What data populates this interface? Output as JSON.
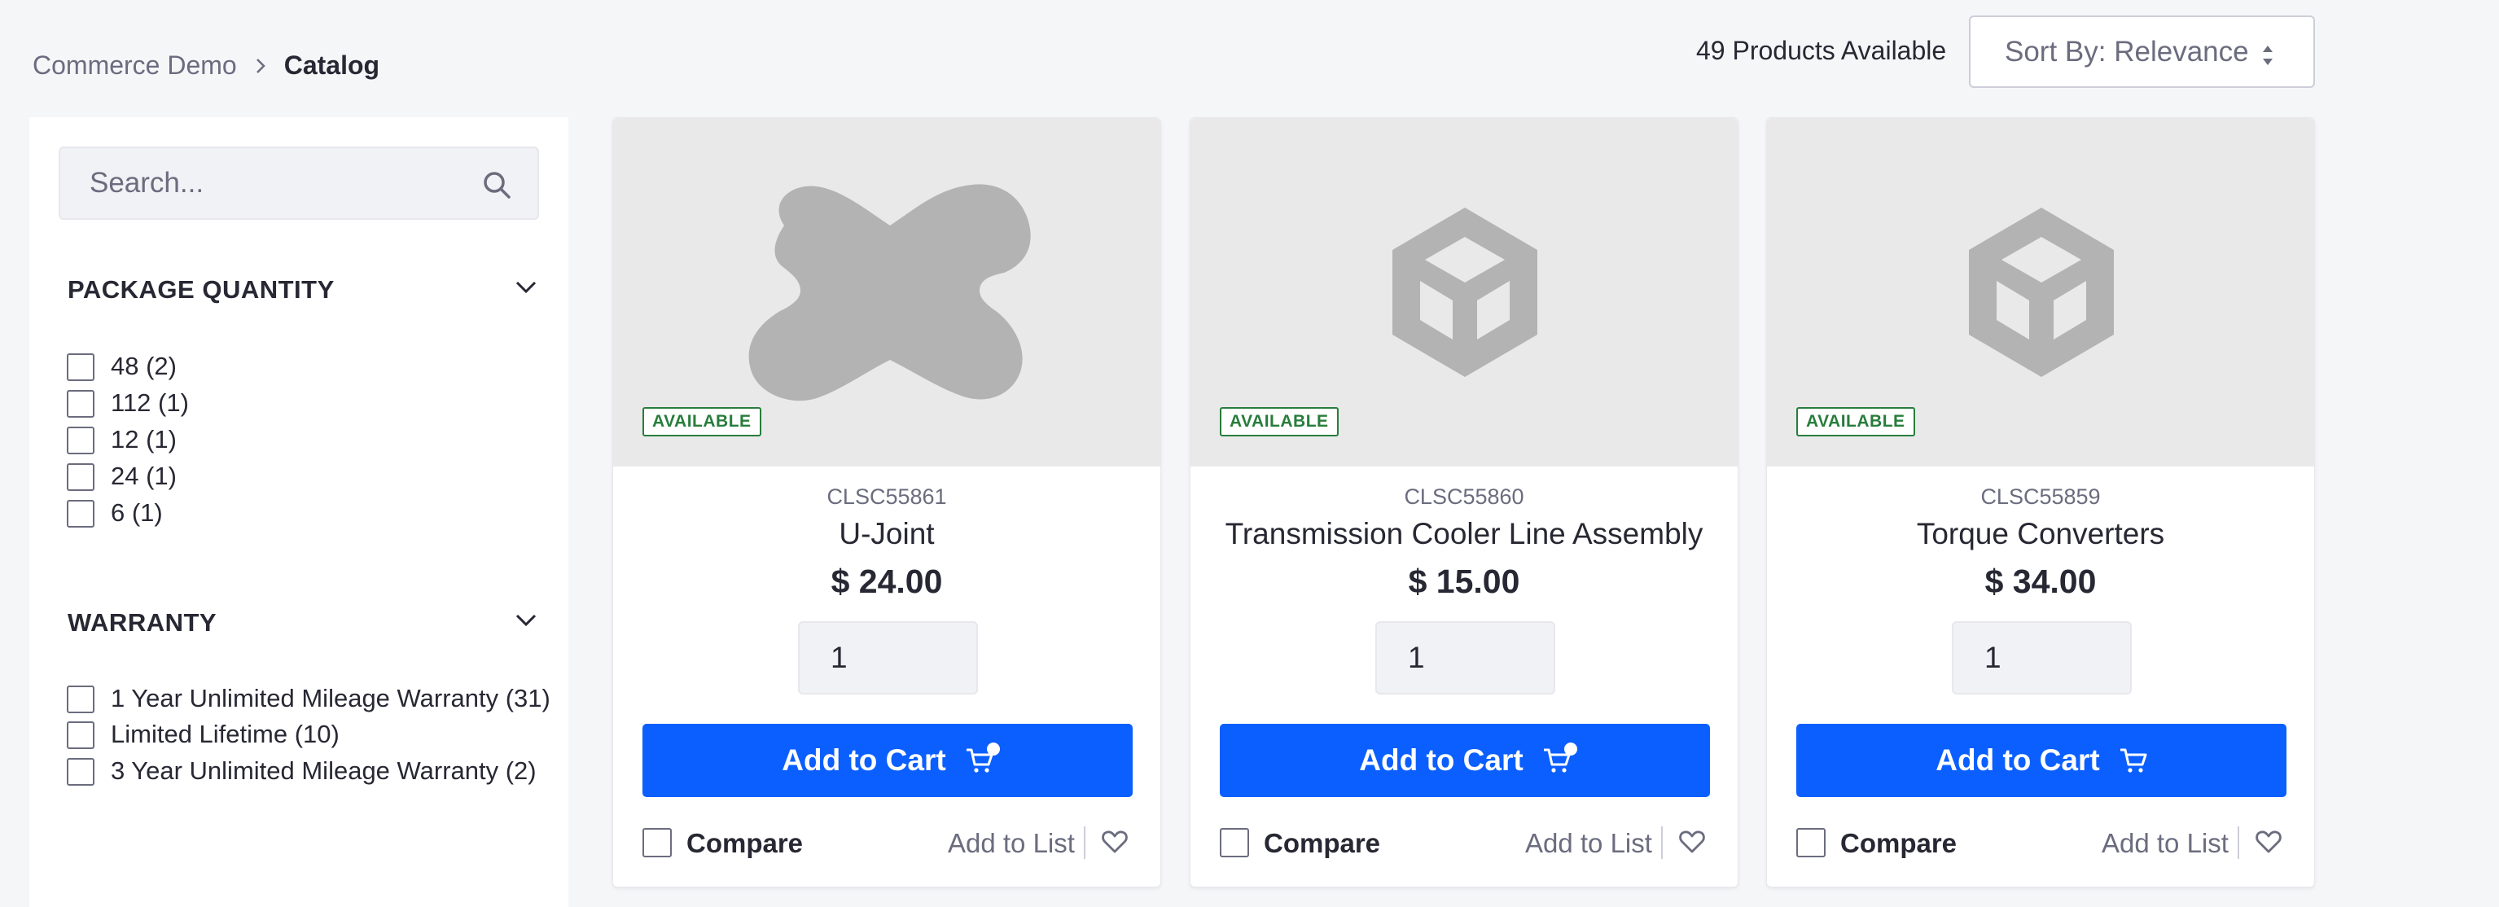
{
  "breadcrumb": {
    "parent": "Commerce Demo",
    "current": "Catalog"
  },
  "header": {
    "products_available": "49 Products Available",
    "sort_label": "Sort By: Relevance"
  },
  "sidebar": {
    "search_placeholder": "Search...",
    "facets": [
      {
        "title": "PACKAGE QUANTITY",
        "options": [
          "48 (2)",
          "112 (1)",
          "12 (1)",
          "24 (1)",
          "6 (1)"
        ]
      },
      {
        "title": "WARRANTY",
        "options": [
          "1 Year Unlimited Mileage Warranty (31)",
          "Limited Lifetime (10)",
          "3 Year Unlimited Mileage Warranty (2)"
        ]
      }
    ]
  },
  "products": [
    {
      "badge": "AVAILABLE",
      "sku": "CLSC55861",
      "name": "U-Joint",
      "price": "$ 24.00",
      "quantity": "1",
      "add_label": "Add to Cart",
      "compare_label": "Compare",
      "add_to_list_label": "Add to List",
      "image_icon": "u-joint-image",
      "cart_notification": true
    },
    {
      "badge": "AVAILABLE",
      "sku": "CLSC55860",
      "name": "Transmission Cooler Line Assembly",
      "price": "$ 15.00",
      "quantity": "1",
      "add_label": "Add to Cart",
      "compare_label": "Compare",
      "add_to_list_label": "Add to List",
      "image_icon": "box-placeholder-icon",
      "cart_notification": true
    },
    {
      "badge": "AVAILABLE",
      "sku": "CLSC55859",
      "name": "Torque Converters",
      "price": "$ 34.00",
      "quantity": "1",
      "add_label": "Add to Cart",
      "compare_label": "Compare",
      "add_to_list_label": "Add to List",
      "image_icon": "box-placeholder-icon",
      "cart_notification": false
    }
  ],
  "colors": {
    "primary": "#0b5fff",
    "available": "#287d3c",
    "placeholder_gray": "#b3b3b3"
  }
}
